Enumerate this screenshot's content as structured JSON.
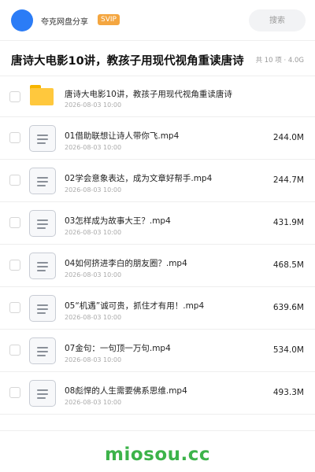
{
  "header": {
    "share_name": "夸克网盘分享",
    "vip_label": "SVIP",
    "search_placeholder": "搜索",
    "avatar_color": "#2b7cf6"
  },
  "folder": {
    "title": "唐诗大电影10讲，教孩子用现代视角重读唐诗",
    "meta": "共 10 项 · 4.0G"
  },
  "files": [
    {
      "name": "唐诗大电影10讲，教孩子用现代视角重读唐诗",
      "date": "2026-08-03 10:00",
      "size": "",
      "type": "folder"
    },
    {
      "name": "01借助联想让诗人带你飞.mp4",
      "date": "2026-08-03 10:00",
      "size": "244.0M",
      "type": "file"
    },
    {
      "name": "02学会意象表达，成为文章好帮手.mp4",
      "date": "2026-08-03 10:00",
      "size": "244.7M",
      "type": "file"
    },
    {
      "name": "03怎样成为故事大王？.mp4",
      "date": "2026-08-03 10:00",
      "size": "431.9M",
      "type": "file"
    },
    {
      "name": "04如何挤进李白的朋友圈？.mp4",
      "date": "2026-08-03 10:00",
      "size": "468.5M",
      "type": "file"
    },
    {
      "name": "05“机遇”诚可贵，抓住才有用！.mp4",
      "date": "2026-08-03 10:00",
      "size": "639.6M",
      "type": "file"
    },
    {
      "name": "07金句：一句顶一万句.mp4",
      "date": "2026-08-03 10:00",
      "size": "534.0M",
      "type": "file"
    },
    {
      "name": "08彪悍的人生需要佛系思维.mp4",
      "date": "2026-08-03 10:00",
      "size": "493.3M",
      "type": "file"
    }
  ],
  "watermark": "miosou.cc",
  "colors": {
    "accent": "#2b7cf6",
    "vip": "#f4a640",
    "folder": "#ffc83d",
    "watermark": "#3cb34a"
  }
}
